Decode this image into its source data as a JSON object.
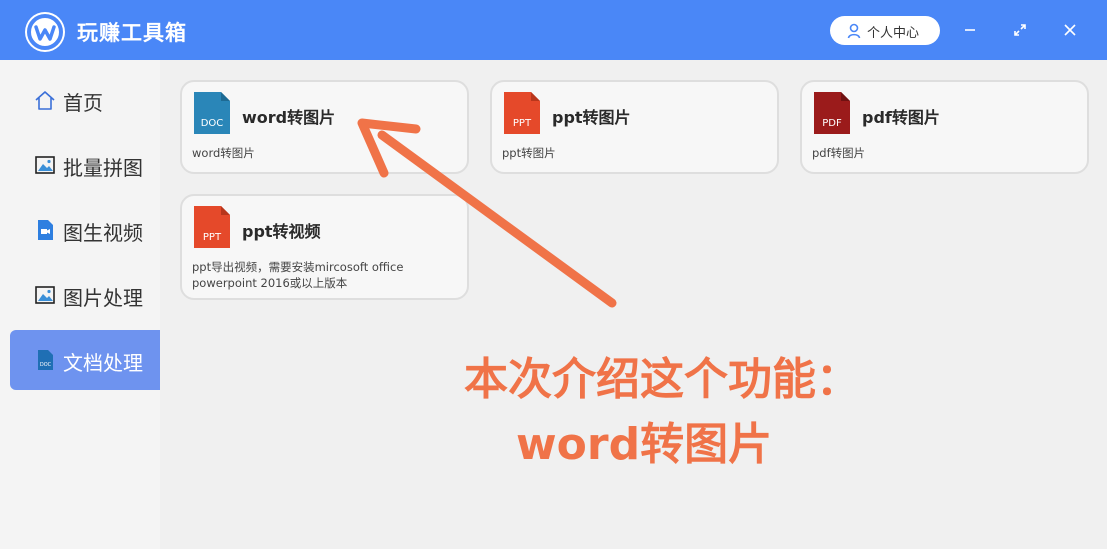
{
  "app": {
    "title": "玩赚工具箱",
    "user_center_label": "个人中心"
  },
  "colors": {
    "titlebar": "#4a87f7",
    "sidebar_active": "#6e93ef",
    "annotation": "#f07348",
    "doc_icon": "#2a86b8",
    "ppt_icon": "#e5492a",
    "pdf_icon": "#9b1b1b"
  },
  "sidebar": {
    "items": [
      {
        "label": "首页",
        "icon": "home-icon",
        "active": false
      },
      {
        "label": "批量拼图",
        "icon": "image-icon",
        "active": false
      },
      {
        "label": "图生视频",
        "icon": "video-file-icon",
        "active": false
      },
      {
        "label": "图片处理",
        "icon": "image-icon",
        "active": false
      },
      {
        "label": "文档处理",
        "icon": "doc-file-icon",
        "active": true
      }
    ]
  },
  "cards": [
    {
      "icon_text": "DOC",
      "title": "word转图片",
      "desc": "word转图片"
    },
    {
      "icon_text": "PPT",
      "title": "ppt转图片",
      "desc": "ppt转图片"
    },
    {
      "icon_text": "PDF",
      "title": "pdf转图片",
      "desc": "pdf转图片"
    },
    {
      "icon_text": "PPT",
      "title": "ppt转视频",
      "desc": "ppt导出视频，需要安装mircosoft office powerpoint 2016或以上版本"
    }
  ],
  "annotation": {
    "line1": "本次介绍这个功能：",
    "line2": "word转图片"
  }
}
